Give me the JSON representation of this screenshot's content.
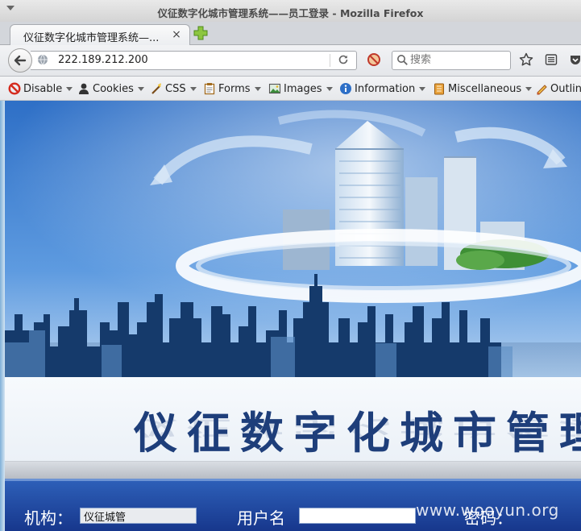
{
  "window": {
    "title": "仪征数字化城市管理系统——员工登录 - Mozilla Firefox"
  },
  "tab": {
    "label": "仪征数字化城市管理系统—...",
    "close": "×"
  },
  "navbar": {
    "url": "222.189.212.200",
    "search_placeholder": "搜索"
  },
  "devbar": {
    "items": [
      {
        "label": "Disable",
        "icon": "disable-icon"
      },
      {
        "label": "Cookies",
        "icon": "cookies-icon"
      },
      {
        "label": "CSS",
        "icon": "css-icon"
      },
      {
        "label": "Forms",
        "icon": "forms-icon"
      },
      {
        "label": "Images",
        "icon": "images-icon"
      },
      {
        "label": "Information",
        "icon": "information-icon"
      },
      {
        "label": "Miscellaneous",
        "icon": "miscellaneous-icon"
      },
      {
        "label": "Outline",
        "icon": "outline-icon"
      }
    ]
  },
  "page": {
    "system_title": "仪征数字化城市管理",
    "login": {
      "org_label": "机构：",
      "org_value": "仪征城管",
      "username_label": "用户名",
      "username_value": "",
      "password_label": "密码："
    },
    "watermark": "www.wooyun.org"
  },
  "colors": {
    "title_blue": "#1e3e7a",
    "login_band": "#1f4598",
    "sky": "#3b7fd0"
  }
}
